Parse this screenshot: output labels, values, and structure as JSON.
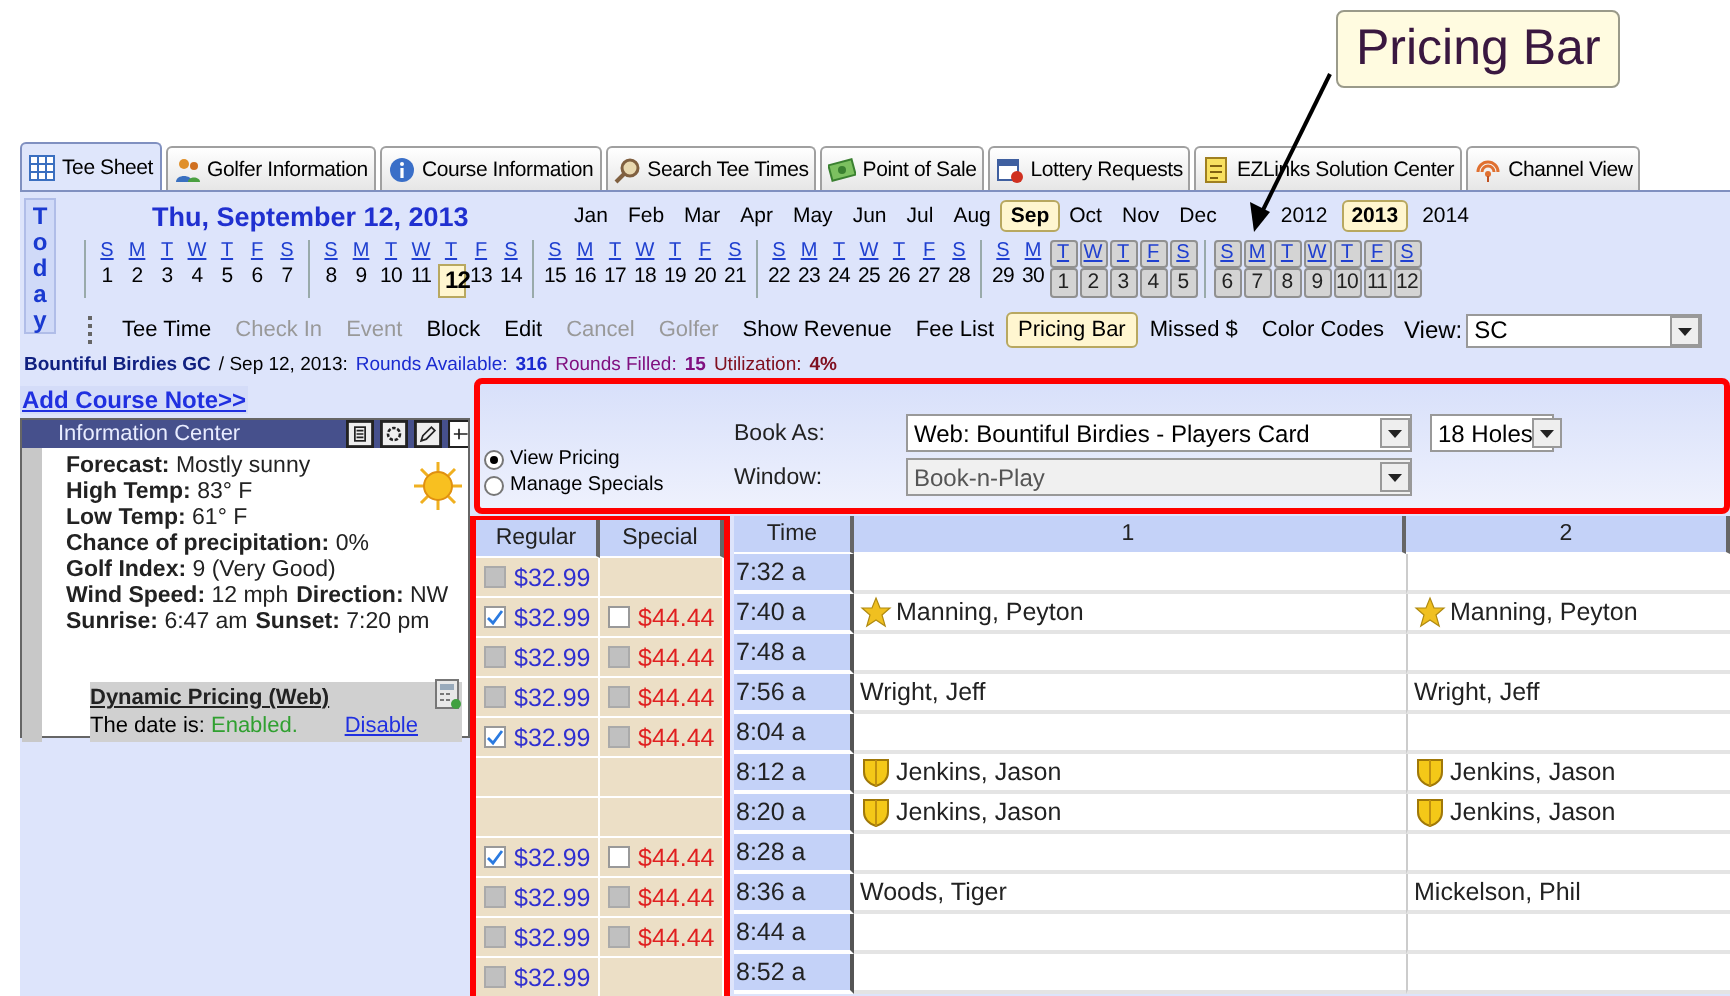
{
  "callout": {
    "text": "Pricing Bar"
  },
  "tabs": [
    {
      "label": "Tee Sheet",
      "selected": true
    },
    {
      "label": "Golfer Information",
      "selected": false
    },
    {
      "label": "Course Information",
      "selected": false
    },
    {
      "label": "Search Tee Times",
      "selected": false
    },
    {
      "label": "Point of Sale",
      "selected": false
    },
    {
      "label": "Lottery Requests",
      "selected": false
    },
    {
      "label": "EZLinks Solution Center",
      "selected": false
    },
    {
      "label": "Channel View",
      "selected": false
    }
  ],
  "calendar": {
    "today_label": "Today",
    "date_title": "Thu, September 12, 2013",
    "months": [
      {
        "label": "Jan",
        "selected": false
      },
      {
        "label": "Feb",
        "selected": false
      },
      {
        "label": "Mar",
        "selected": false
      },
      {
        "label": "Apr",
        "selected": false
      },
      {
        "label": "May",
        "selected": false
      },
      {
        "label": "Jun",
        "selected": false
      },
      {
        "label": "Jul",
        "selected": false
      },
      {
        "label": "Aug",
        "selected": false
      },
      {
        "label": "Sep",
        "selected": true
      },
      {
        "label": "Oct",
        "selected": false
      },
      {
        "label": "Nov",
        "selected": false
      },
      {
        "label": "Dec",
        "selected": false
      }
    ],
    "years": [
      {
        "label": "2012",
        "selected": false
      },
      {
        "label": "2013",
        "selected": true
      },
      {
        "label": "2014",
        "selected": false
      }
    ],
    "weeks": [
      [
        {
          "day": "S",
          "date": "1",
          "selected": false,
          "outside": false
        },
        {
          "day": "M",
          "date": "2",
          "selected": false,
          "outside": false
        },
        {
          "day": "T",
          "date": "3",
          "selected": false,
          "outside": false
        },
        {
          "day": "W",
          "date": "4",
          "selected": false,
          "outside": false
        },
        {
          "day": "T",
          "date": "5",
          "selected": false,
          "outside": false
        },
        {
          "day": "F",
          "date": "6",
          "selected": false,
          "outside": false
        },
        {
          "day": "S",
          "date": "7",
          "selected": false,
          "outside": false
        }
      ],
      [
        {
          "day": "S",
          "date": "8",
          "selected": false,
          "outside": false
        },
        {
          "day": "M",
          "date": "9",
          "selected": false,
          "outside": false
        },
        {
          "day": "T",
          "date": "10",
          "selected": false,
          "outside": false
        },
        {
          "day": "W",
          "date": "11",
          "selected": false,
          "outside": false
        },
        {
          "day": "T",
          "date": "12",
          "selected": true,
          "outside": false
        },
        {
          "day": "F",
          "date": "13",
          "selected": false,
          "outside": false
        },
        {
          "day": "S",
          "date": "14",
          "selected": false,
          "outside": false
        }
      ],
      [
        {
          "day": "S",
          "date": "15",
          "selected": false,
          "outside": false
        },
        {
          "day": "M",
          "date": "16",
          "selected": false,
          "outside": false
        },
        {
          "day": "T",
          "date": "17",
          "selected": false,
          "outside": false
        },
        {
          "day": "W",
          "date": "18",
          "selected": false,
          "outside": false
        },
        {
          "day": "T",
          "date": "19",
          "selected": false,
          "outside": false
        },
        {
          "day": "F",
          "date": "20",
          "selected": false,
          "outside": false
        },
        {
          "day": "S",
          "date": "21",
          "selected": false,
          "outside": false
        }
      ],
      [
        {
          "day": "S",
          "date": "22",
          "selected": false,
          "outside": false
        },
        {
          "day": "M",
          "date": "23",
          "selected": false,
          "outside": false
        },
        {
          "day": "T",
          "date": "24",
          "selected": false,
          "outside": false
        },
        {
          "day": "W",
          "date": "25",
          "selected": false,
          "outside": false
        },
        {
          "day": "T",
          "date": "26",
          "selected": false,
          "outside": false
        },
        {
          "day": "F",
          "date": "27",
          "selected": false,
          "outside": false
        },
        {
          "day": "S",
          "date": "28",
          "selected": false,
          "outside": false
        }
      ],
      [
        {
          "day": "S",
          "date": "29",
          "selected": false,
          "outside": false
        },
        {
          "day": "M",
          "date": "30",
          "selected": false,
          "outside": false
        },
        {
          "day": "T",
          "date": "1",
          "selected": false,
          "outside": true
        },
        {
          "day": "W",
          "date": "2",
          "selected": false,
          "outside": true
        },
        {
          "day": "T",
          "date": "3",
          "selected": false,
          "outside": true
        },
        {
          "day": "F",
          "date": "4",
          "selected": false,
          "outside": true
        },
        {
          "day": "S",
          "date": "5",
          "selected": false,
          "outside": true
        }
      ],
      [
        {
          "day": "S",
          "date": "6",
          "selected": false,
          "outside": true
        },
        {
          "day": "M",
          "date": "7",
          "selected": false,
          "outside": true
        },
        {
          "day": "T",
          "date": "8",
          "selected": false,
          "outside": true
        },
        {
          "day": "W",
          "date": "9",
          "selected": false,
          "outside": true
        },
        {
          "day": "T",
          "date": "10",
          "selected": false,
          "outside": true
        },
        {
          "day": "F",
          "date": "11",
          "selected": false,
          "outside": true
        },
        {
          "day": "S",
          "date": "12",
          "selected": false,
          "outside": true
        }
      ]
    ]
  },
  "toolbar": {
    "items": [
      {
        "label": "Tee Time",
        "disabled": false,
        "selected": false
      },
      {
        "label": "Check In",
        "disabled": true,
        "selected": false
      },
      {
        "label": "Event",
        "disabled": true,
        "selected": false
      },
      {
        "label": "Block",
        "disabled": false,
        "selected": false
      },
      {
        "label": "Edit",
        "disabled": false,
        "selected": false
      },
      {
        "label": "Cancel",
        "disabled": true,
        "selected": false
      },
      {
        "label": "Golfer",
        "disabled": true,
        "selected": false
      },
      {
        "label": "Show Revenue",
        "disabled": false,
        "selected": false
      },
      {
        "label": "Fee List",
        "disabled": false,
        "selected": false
      },
      {
        "label": "Pricing Bar",
        "disabled": false,
        "selected": true
      },
      {
        "label": "Missed $",
        "disabled": false,
        "selected": false
      },
      {
        "label": "Color Codes",
        "disabled": false,
        "selected": false
      }
    ],
    "view_label": "View:",
    "view_value": "SC"
  },
  "status_bar": [
    {
      "text": "Bountiful Birdies GC",
      "kind": "course"
    },
    {
      "text": "/ Sep 12, 2013:",
      "kind": "date"
    },
    {
      "text": "Rounds Available:",
      "kind": "available_label"
    },
    {
      "text": "316",
      "kind": "available_value"
    },
    {
      "text": "Rounds Filled:",
      "kind": "filled_label"
    },
    {
      "text": "15",
      "kind": "filled_value"
    },
    {
      "text": "Utilization:",
      "kind": "util_label"
    },
    {
      "text": "4%",
      "kind": "util_value"
    }
  ],
  "course_note_link": "Add Course Note>>",
  "info_center": {
    "title": "Information Center",
    "lines": [
      [
        "**Forecast:** Mostly sunny"
      ],
      [
        "**High Temp:** 83° F"
      ],
      [
        "**Low Temp:** 61° F"
      ],
      [
        "**Chance of precipitation:** 0%"
      ],
      [
        "**Golf Index:** 9 (Very Good)"
      ],
      [
        "**Wind Speed:** 12 mph",
        "**Direction:** NW"
      ],
      [
        "**Sunrise:** 6:47 am",
        "**Sunset:** 7:20 pm"
      ]
    ],
    "dynamic_pricing": {
      "title": "Dynamic Pricing (Web)",
      "status_label": "The date is:",
      "status_value": "Enabled.",
      "action": "Disable"
    }
  },
  "pricing_bar": {
    "modes": [
      {
        "label": "View Pricing",
        "selected": true
      },
      {
        "label": "Manage Specials",
        "selected": false
      }
    ],
    "book_as": {
      "label": "Book As:",
      "value": "Web: Bountiful Birdies - Players Card"
    },
    "window": {
      "label": "Window:",
      "value": "Book-n-Play",
      "disabled": true
    },
    "holes": {
      "value": "18 Holes"
    }
  },
  "table": {
    "columns": [
      "Regular",
      "Special",
      "Time",
      "1",
      "2"
    ],
    "rows": [
      {
        "regular": {
          "price": "$32.99",
          "checked": false,
          "disabled": true
        },
        "time": "7:32 a"
      },
      {
        "regular": {
          "price": "$32.99",
          "checked": true,
          "disabled": false
        },
        "special": {
          "price": "$44.44",
          "checked": false,
          "disabled": false
        },
        "time": "7:40 a",
        "players": [
          {
            "name": "Manning, Peyton",
            "kind": "star"
          },
          {
            "name": "Manning, Peyton",
            "kind": "star"
          }
        ]
      },
      {
        "regular": {
          "price": "$32.99",
          "checked": false,
          "disabled": true
        },
        "special": {
          "price": "$44.44",
          "checked": false,
          "disabled": true
        },
        "time": "7:48 a"
      },
      {
        "regular": {
          "price": "$32.99",
          "checked": false,
          "disabled": true
        },
        "special": {
          "price": "$44.44",
          "checked": false,
          "disabled": true
        },
        "time": "7:56 a",
        "players": [
          {
            "name": "Wright, Jeff",
            "kind": "plain"
          },
          {
            "name": "Wright, Jeff",
            "kind": "plain"
          }
        ]
      },
      {
        "regular": {
          "price": "$32.99",
          "checked": true,
          "disabled": false
        },
        "special": {
          "price": "$44.44",
          "checked": false,
          "disabled": true
        },
        "time": "8:04 a"
      },
      {
        "time": "8:12 a",
        "players": [
          {
            "name": "Jenkins, Jason",
            "kind": "shield"
          },
          {
            "name": "Jenkins, Jason",
            "kind": "shield"
          }
        ]
      },
      {
        "time": "8:20 a",
        "players": [
          {
            "name": "Jenkins, Jason",
            "kind": "shield"
          },
          {
            "name": "Jenkins, Jason",
            "kind": "shield"
          }
        ]
      },
      {
        "regular": {
          "price": "$32.99",
          "checked": true,
          "disabled": false
        },
        "special": {
          "price": "$44.44",
          "checked": false,
          "disabled": false
        },
        "time": "8:28 a"
      },
      {
        "regular": {
          "price": "$32.99",
          "checked": false,
          "disabled": true
        },
        "special": {
          "price": "$44.44",
          "checked": false,
          "disabled": true
        },
        "time": "8:36 a",
        "players": [
          {
            "name": "Woods, Tiger",
            "kind": "plain"
          },
          {
            "name": "Mickelson, Phil",
            "kind": "plain"
          }
        ]
      },
      {
        "regular": {
          "price": "$32.99",
          "checked": false,
          "disabled": true
        },
        "special": {
          "price": "$44.44",
          "checked": false,
          "disabled": true
        },
        "time": "8:44 a"
      },
      {
        "regular": {
          "price": "$32.99",
          "checked": false,
          "disabled": true
        },
        "time": "8:52 a"
      }
    ]
  }
}
